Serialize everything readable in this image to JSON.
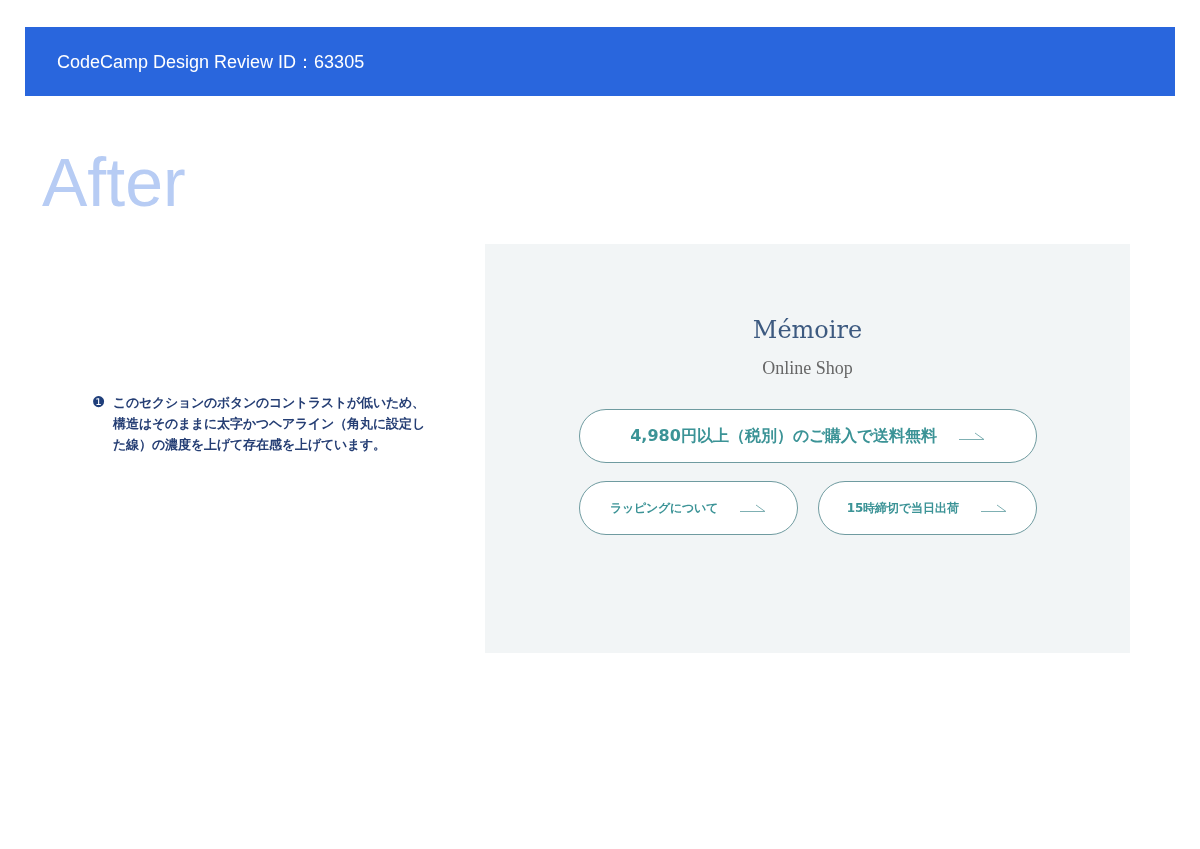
{
  "header": {
    "title": "CodeCamp Design Review ID：63305"
  },
  "heading": "After",
  "note": {
    "marker": "❶",
    "text": "このセクションのボタンのコントラストが低いため、構造はそのままに太字かつヘアライン（角丸に設定した線）の濃度を上げて存在感を上げています。"
  },
  "preview": {
    "brand": "Mémoire",
    "subtitle": "Online Shop",
    "buttons": [
      {
        "label": "4,980円以上（税別）のご購入で送料無料",
        "kind": "wide"
      },
      {
        "label": "ラッピングについて",
        "kind": "half"
      },
      {
        "label": "15時締切で当日出荷",
        "kind": "half"
      }
    ]
  }
}
